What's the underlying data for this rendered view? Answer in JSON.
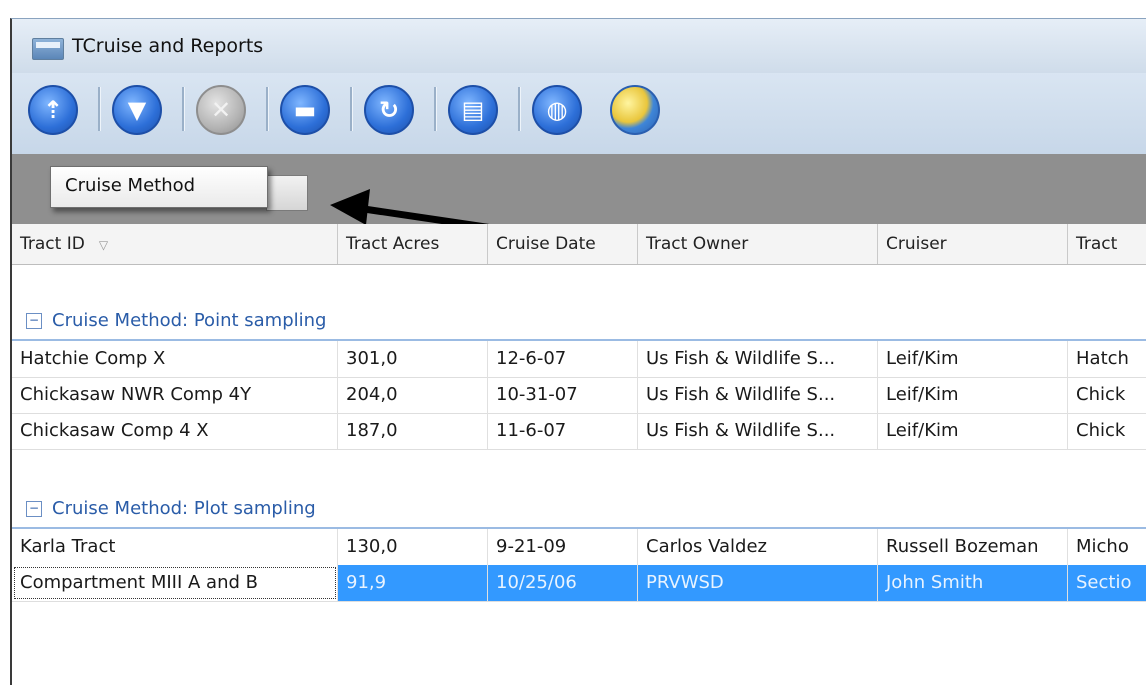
{
  "window": {
    "title": "TCruise and Reports"
  },
  "toolbar": {
    "buttons": [
      {
        "icon": "upload-icon",
        "glyph": "⇡",
        "style": "blue"
      },
      {
        "icon": "filter-icon",
        "glyph": "▼",
        "style": "blue"
      },
      {
        "icon": "clear-filter-icon",
        "glyph": "✕",
        "style": "gray"
      },
      {
        "icon": "print-icon",
        "glyph": "▬",
        "style": "blue"
      },
      {
        "icon": "refresh-icon",
        "glyph": "↻",
        "style": "blue"
      },
      {
        "icon": "document-icon",
        "glyph": "▤",
        "style": "blue"
      },
      {
        "icon": "attach-icon",
        "glyph": "◍",
        "style": "blue"
      },
      {
        "icon": "globe-icon",
        "glyph": "",
        "style": "globe"
      }
    ]
  },
  "group_panel": {
    "chip_label": "Cruise Method"
  },
  "table": {
    "columns": [
      "Tract ID",
      "Tract Acres",
      "Cruise Date",
      "Tract Owner",
      "Cruiser",
      "Tract"
    ],
    "groups": [
      {
        "label": "Cruise Method: Point sampling",
        "toggle": "−",
        "rows": [
          [
            "Hatchie Comp X",
            "301,0",
            "12-6-07",
            "Us Fish & Wildlife S...",
            "Leif/Kim",
            "Hatch"
          ],
          [
            "Chickasaw NWR Comp 4Y",
            "204,0",
            "10-31-07",
            "Us Fish & Wildlife S...",
            "Leif/Kim",
            "Chick"
          ],
          [
            "Chickasaw Comp 4 X",
            "187,0",
            "11-6-07",
            "Us Fish & Wildlife S...",
            "Leif/Kim",
            "Chick"
          ]
        ]
      },
      {
        "label": "Cruise Method: Plot sampling",
        "toggle": "−",
        "rows": [
          [
            "Karla Tract",
            "130,0",
            "9-21-09",
            "Carlos Valdez",
            "Russell Bozeman",
            "Micho"
          ],
          [
            "Compartment MIII A and B",
            "91,9",
            "10/25/06",
            "PRVWSD",
            "John Smith",
            "Sectio"
          ]
        ]
      }
    ]
  },
  "colors": {
    "selection": "#3399ff",
    "group_text": "#2a5ca8",
    "group_bar": "#8f8f8f"
  }
}
